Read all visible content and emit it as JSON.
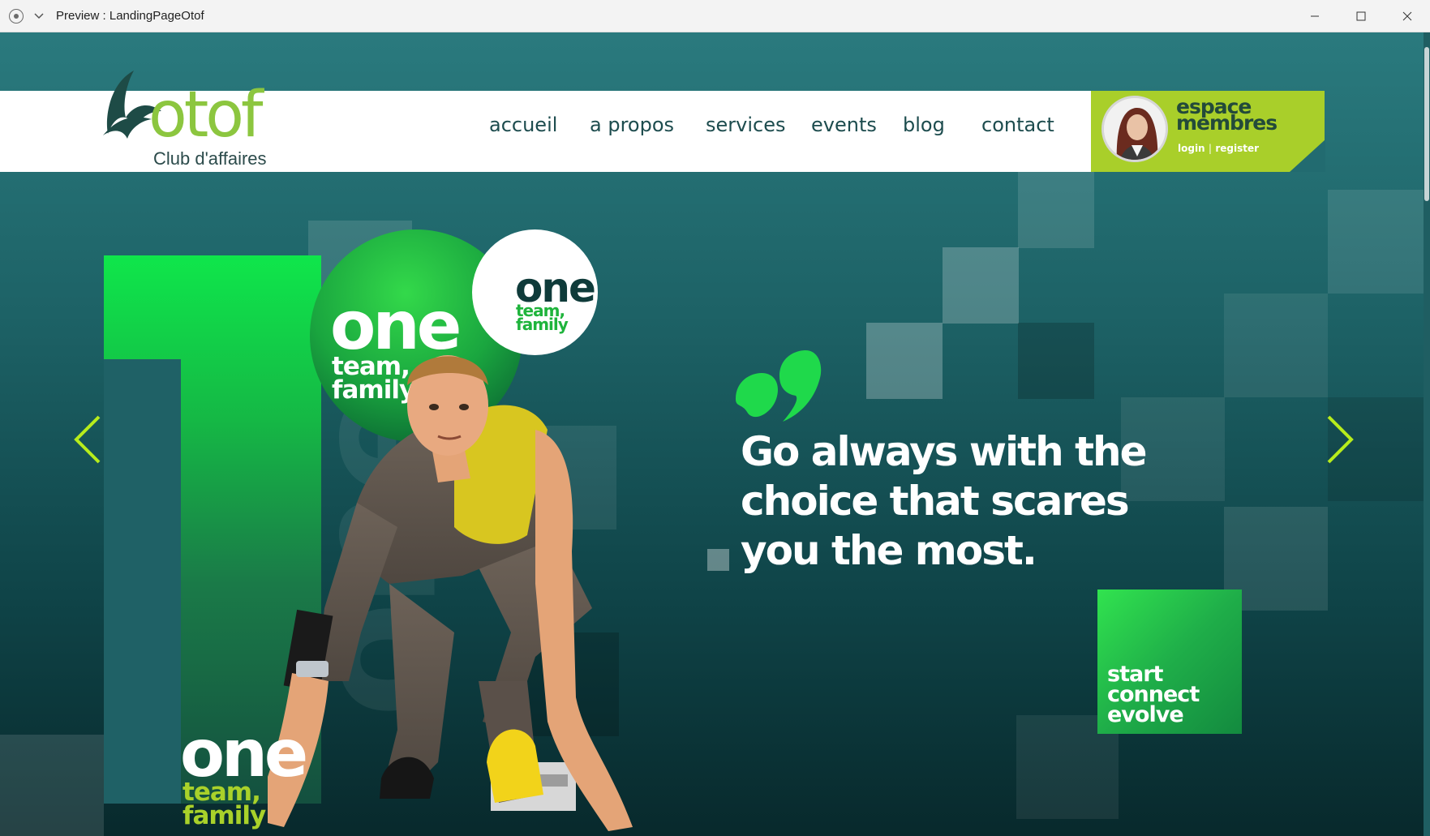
{
  "window": {
    "title": "Preview : LandingPageOtof"
  },
  "brand": {
    "logo_word": "otof",
    "logo_sub": "Club d'affaires",
    "accent_green": "#a9cf2a",
    "bright_green": "#1fd94b",
    "teal_bg": "#1d6266"
  },
  "nav": {
    "items": [
      "accueil",
      "a propos",
      "services",
      "events",
      "blog",
      "contact"
    ]
  },
  "members": {
    "title_line1": "espace",
    "title_line2": "membres",
    "login": "login",
    "separator": "|",
    "register": "register"
  },
  "hero": {
    "quote": "Go always with the choice that scares you the most.",
    "card_line1": "start",
    "card_line2": "connect",
    "card_line3": "evolve",
    "one_big": "one",
    "tf_big_1": "team,",
    "tf_big_2": "family",
    "one_small": "one",
    "tf_small_1": "team,",
    "tf_small_2": "family",
    "one_bottom": "one",
    "tf_bottom_1": "team,",
    "tf_bottom_2": "family",
    "one_vertical": "one"
  },
  "icons": {
    "prev": "chevron-left-icon",
    "next": "chevron-right-icon",
    "quote": "quote-icon"
  }
}
